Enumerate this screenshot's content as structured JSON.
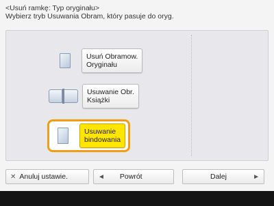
{
  "header": {
    "line1": "<Usuń ramkę: Typ oryginału>",
    "line2": "Wybierz tryb Usuwania Obram, który pasuje do oryg."
  },
  "options": [
    {
      "label": "Usuń Obramow.\nOryginału",
      "icon": "document-icon",
      "selected": false
    },
    {
      "label": "Usuwanie Obr.\nKsiążki",
      "icon": "open-book-icon",
      "selected": false
    },
    {
      "label": "Usuwanie\nbindowania",
      "icon": "bound-document-icon",
      "selected": true
    }
  ],
  "bottom": {
    "cancel_label": "Anuluj ustawie.",
    "back_label": "Powrót",
    "next_label": "Dalej"
  },
  "colors": {
    "selected_fill": "#ffe500",
    "selected_outline": "#f39c12",
    "footer": "#141414"
  }
}
